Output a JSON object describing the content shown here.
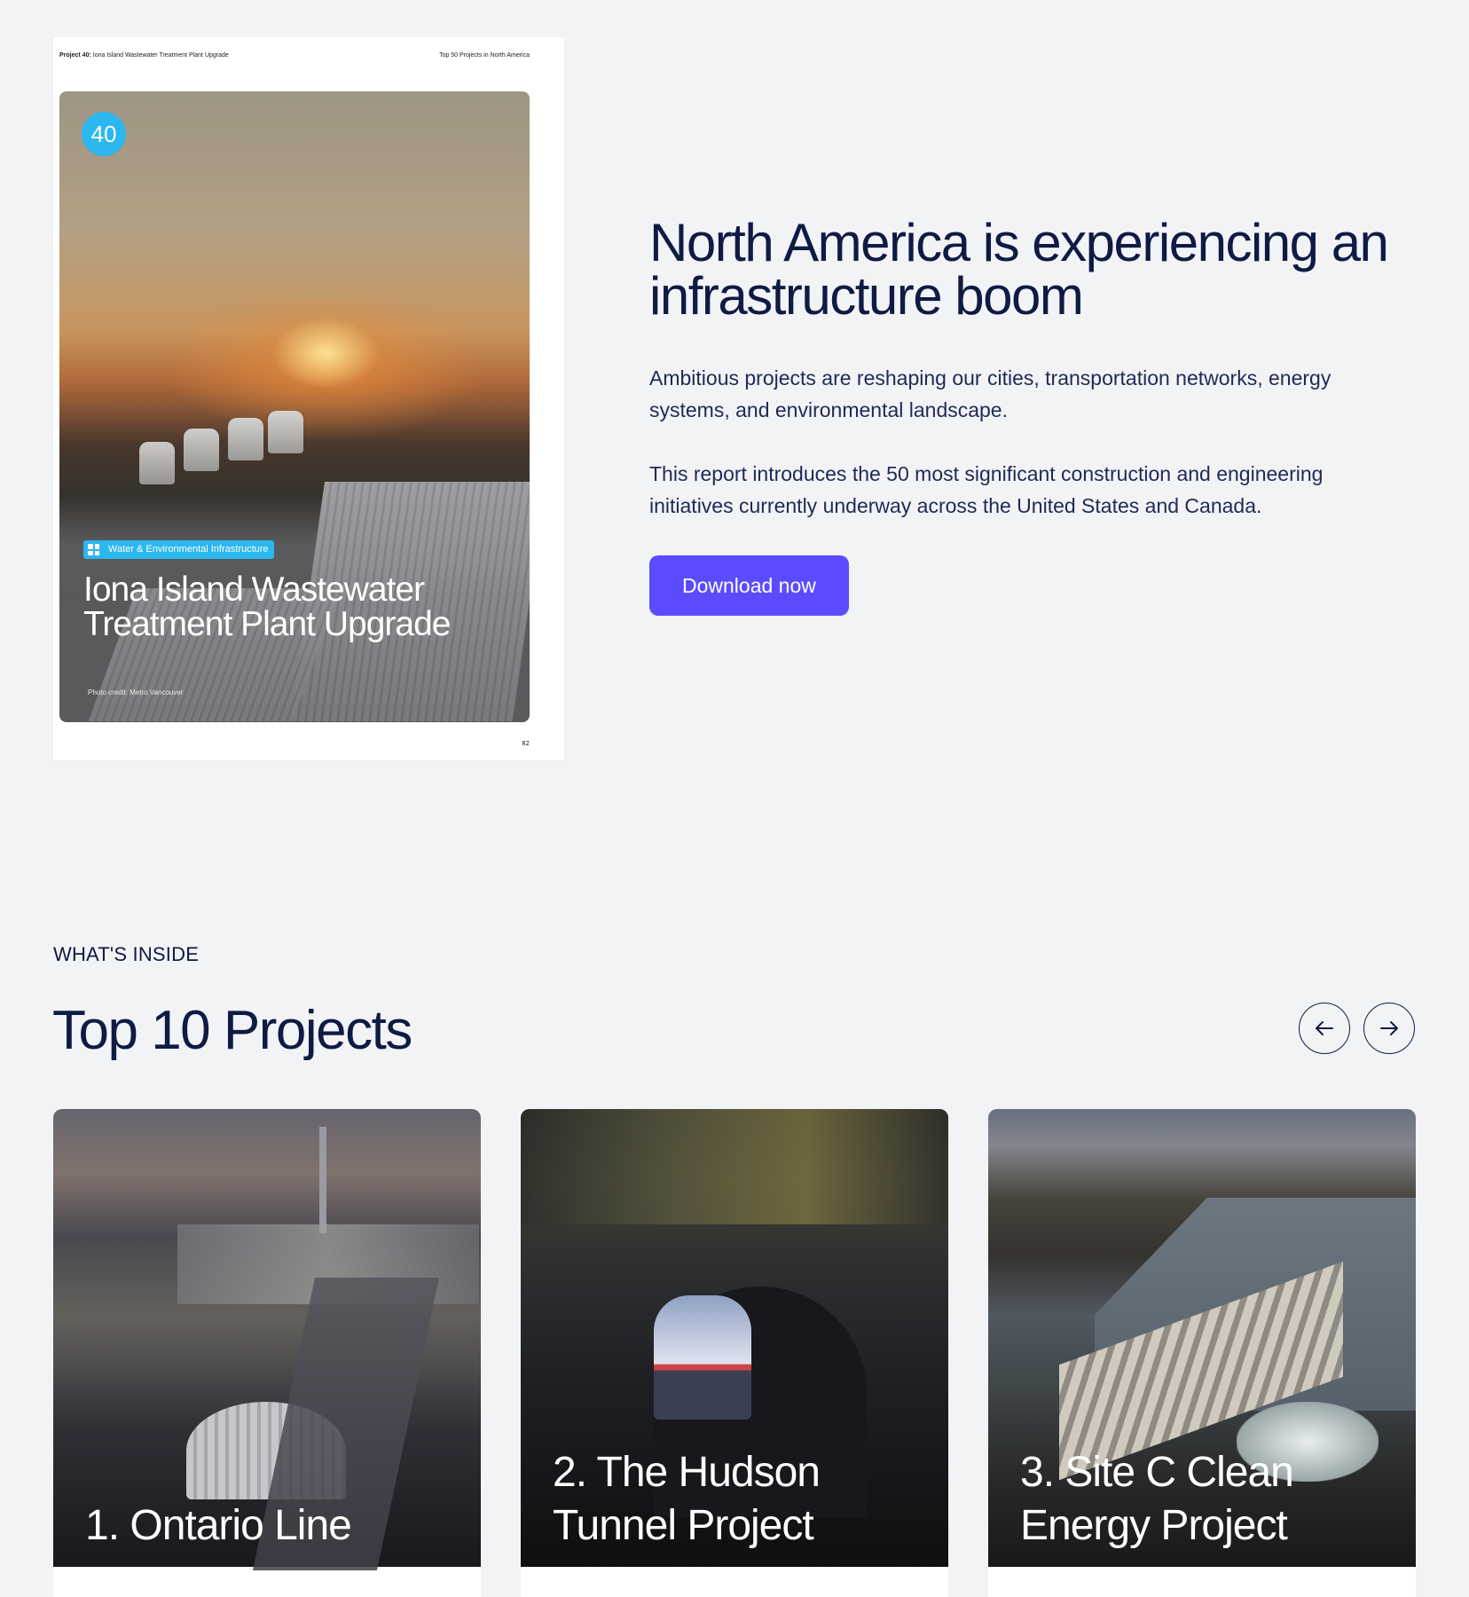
{
  "report_preview": {
    "header_project_bold": "Project 40:",
    "header_project_title": "Iona Island Wastewater Treatment Plant Upgrade",
    "header_right": "Top 50 Projects in North America",
    "badge_number": "40",
    "category": "Water & Environmental Infrastructure",
    "title": "Iona Island Wastewater Treatment Plant Upgrade",
    "photo_credit": "Photo credit:  Metro Vancouver",
    "page_number": "82"
  },
  "hero": {
    "title": "North America is experiencing an infrastructure boom",
    "paragraph_1": "Ambitious projects are reshaping our cities, transportation networks, energy systems, and environmental landscape.",
    "paragraph_2": "This report introduces the 50 most significant construction and engineering initiatives currently underway across the United States and Canada.",
    "cta_label": "Download now"
  },
  "section": {
    "eyebrow": "WHAT'S INSIDE",
    "title": "Top 10 Projects"
  },
  "cards": [
    {
      "title": "1. Ontario Line"
    },
    {
      "title": "2. The Hudson Tunnel Project"
    },
    {
      "title": "3. Site C Clean Energy Project"
    }
  ],
  "colors": {
    "page_background": "#f2f3f5",
    "text_primary": "#0f1a45",
    "cta_background": "#5b4bff",
    "accent_badge": "#2bb7f0"
  },
  "icons": {
    "prev": "arrow-left-icon",
    "next": "arrow-right-icon",
    "category": "grid-icon"
  }
}
